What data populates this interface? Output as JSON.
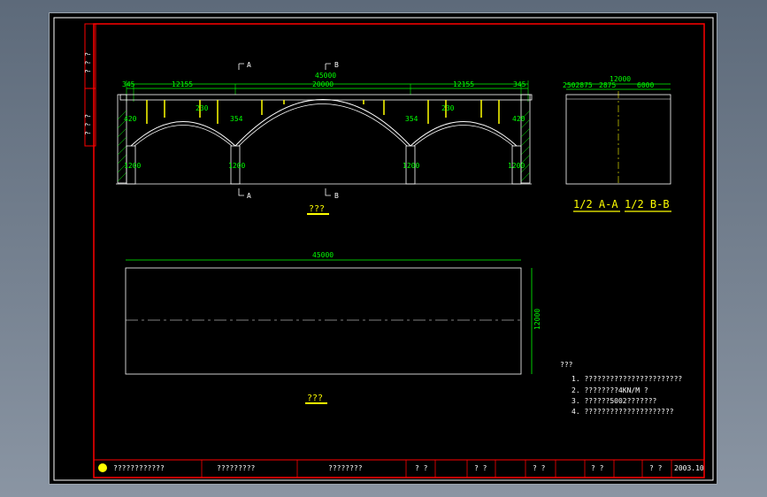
{
  "drawing": {
    "elevation": {
      "overall_dim": "45000",
      "span_dims": [
        "12155",
        "20000",
        "12155"
      ],
      "end_dims": [
        "345",
        "345"
      ],
      "pier_labels": [
        "1200",
        "1200",
        "1200",
        "1200"
      ],
      "arch_labels": [
        "230",
        "230",
        "354",
        "354",
        "420",
        "420"
      ],
      "section_a_label": "A",
      "section_b_label": "B",
      "view_title": "???"
    },
    "section": {
      "overall_dim": "12000",
      "part_dims": [
        "2502875",
        "2875",
        "6000"
      ],
      "title_a": "1/2 A-A",
      "title_b": "1/2 B-B"
    },
    "plan": {
      "length_dim": "45000",
      "width_dim": "12000",
      "view_title": "???"
    },
    "notes": {
      "heading": "???",
      "items": [
        "1.  ???????????????????????",
        "2.   ????????4KN/M ?",
        "3.   ??????5002???????",
        "4.   ?????????????????????"
      ]
    }
  },
  "left_strip": {
    "cells": [
      "? ? ?",
      "? ? ?"
    ]
  },
  "title_block": {
    "cells": [
      "????????????",
      "?????????",
      "????????",
      "? ?",
      "? ?",
      "? ?",
      "? ?",
      "? ?"
    ],
    "date": "2003.10"
  },
  "colors": {
    "frame": "#ff0000",
    "dims": "#00ff00",
    "lines": "#ffffff",
    "titles": "#ffff00"
  }
}
